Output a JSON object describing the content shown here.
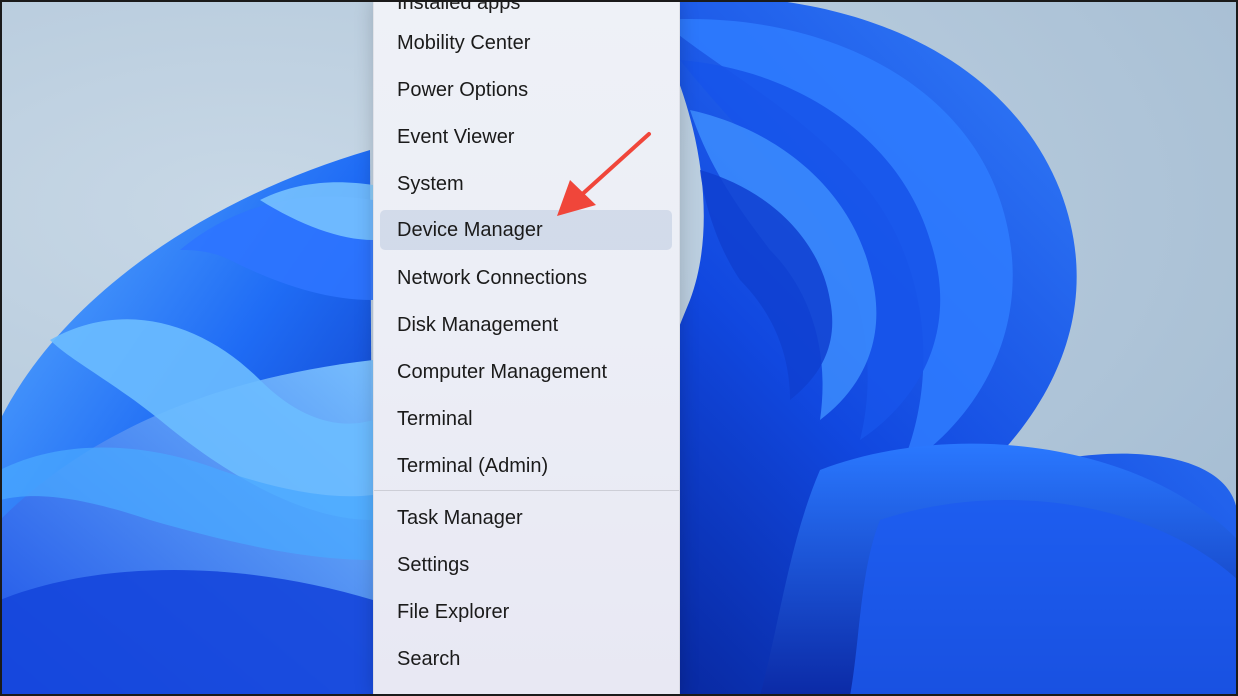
{
  "menu": {
    "items": [
      {
        "label": "Installed apps"
      },
      {
        "label": "Mobility Center"
      },
      {
        "label": "Power Options"
      },
      {
        "label": "Event Viewer"
      },
      {
        "label": "System"
      },
      {
        "label": "Device Manager"
      },
      {
        "label": "Network Connections"
      },
      {
        "label": "Disk Management"
      },
      {
        "label": "Computer Management"
      },
      {
        "label": "Terminal"
      },
      {
        "label": "Terminal (Admin)"
      },
      {
        "label": "Task Manager"
      },
      {
        "label": "Settings"
      },
      {
        "label": "File Explorer"
      },
      {
        "label": "Search"
      }
    ],
    "highlighted_item": "Device Manager"
  },
  "colors": {
    "menu_background": "#eceef6",
    "menu_text": "#1b1b1b",
    "hover_background": "#c4cfe2",
    "arrow": "#f0463a",
    "wallpaper_blue": "#1a5cf0"
  }
}
